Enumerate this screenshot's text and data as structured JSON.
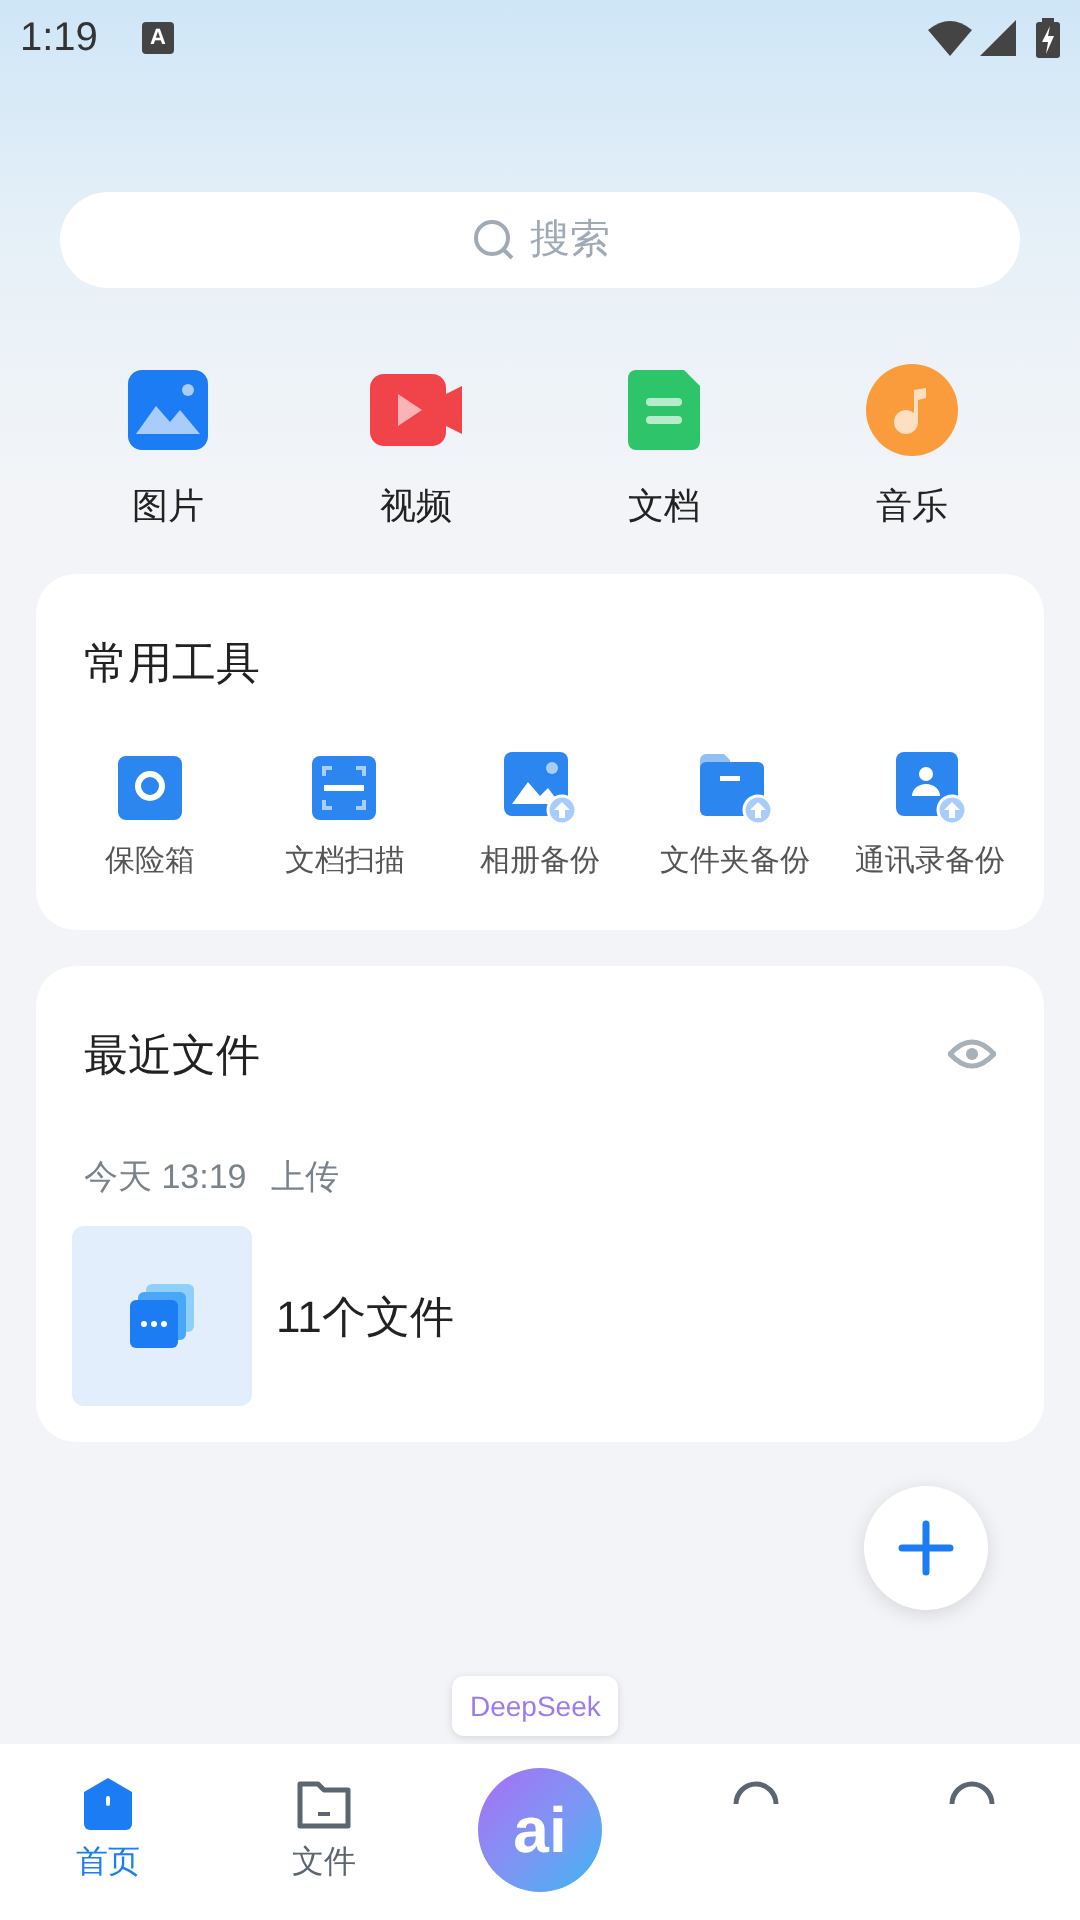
{
  "status_bar": {
    "time": "1:19",
    "notification": "A"
  },
  "search": {
    "placeholder": "搜索"
  },
  "categories": [
    {
      "kind": "image",
      "label": "图片"
    },
    {
      "kind": "video",
      "label": "视频"
    },
    {
      "kind": "document",
      "label": "文档"
    },
    {
      "kind": "music",
      "label": "音乐"
    }
  ],
  "tools": {
    "title": "常用工具",
    "items": [
      {
        "kind": "safe",
        "label": "保险箱"
      },
      {
        "kind": "scan",
        "label": "文档扫描"
      },
      {
        "kind": "album",
        "label": "相册备份"
      },
      {
        "kind": "folder",
        "label": "文件夹备份"
      },
      {
        "kind": "contacts",
        "label": "通讯录备份"
      }
    ]
  },
  "recent": {
    "title": "最近文件",
    "time": "今天 13:19",
    "action": "上传",
    "file_count": "11个文件"
  },
  "ai_tooltip": "DeepSeek",
  "ai_button": "ai",
  "tabs": [
    {
      "kind": "home",
      "label": "首页",
      "selected": true
    },
    {
      "kind": "files",
      "label": "文件",
      "selected": false
    },
    {
      "kind": "ai",
      "selected": false
    },
    {
      "kind": "circle",
      "selected": false
    },
    {
      "kind": "circle",
      "selected": false
    }
  ]
}
